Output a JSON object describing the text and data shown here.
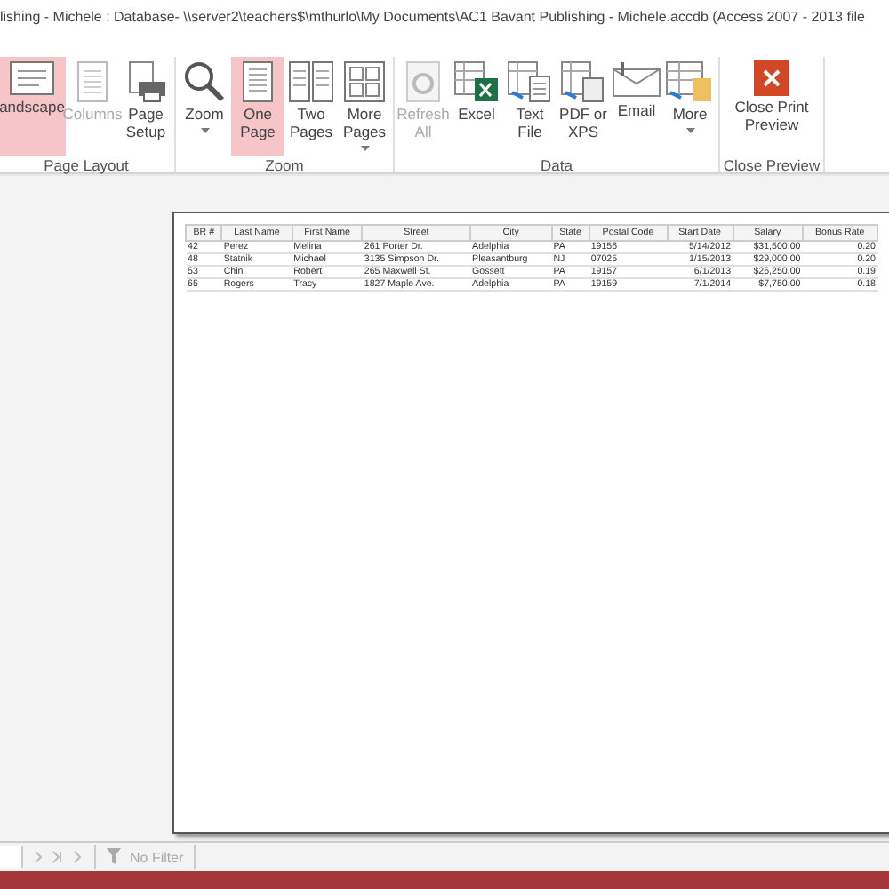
{
  "window": {
    "title": "lishing - Michele : Database- \\\\server2\\teachers$\\mthurlo\\My Documents\\AC1 Bavant Publishing - Michele.accdb (Access 2007 - 2013 file"
  },
  "ribbon": {
    "groups": [
      {
        "label": "Page Layout",
        "buttons": [
          {
            "label": "andscape",
            "selected": true,
            "disabled": false,
            "caret": false
          },
          {
            "label": "Columns",
            "selected": false,
            "disabled": true,
            "caret": false
          },
          {
            "label": "Page Setup",
            "selected": false,
            "disabled": false,
            "caret": false
          }
        ]
      },
      {
        "label": "Zoom",
        "buttons": [
          {
            "label": "Zoom",
            "selected": false,
            "disabled": false,
            "caret": true
          },
          {
            "label": "One Page",
            "selected": true,
            "disabled": false,
            "caret": false
          },
          {
            "label": "Two Pages",
            "selected": false,
            "disabled": false,
            "caret": false
          },
          {
            "label": "More Pages",
            "selected": false,
            "disabled": false,
            "caret": true
          }
        ]
      },
      {
        "label": "Data",
        "buttons": [
          {
            "label": "Refresh All",
            "selected": false,
            "disabled": true,
            "caret": false
          },
          {
            "label": "Excel",
            "selected": false,
            "disabled": false,
            "caret": false
          },
          {
            "label": "Text File",
            "selected": false,
            "disabled": false,
            "caret": false
          },
          {
            "label": "PDF or XPS",
            "selected": false,
            "disabled": false,
            "caret": false
          },
          {
            "label": "Email",
            "selected": false,
            "disabled": false,
            "caret": false
          },
          {
            "label": "More",
            "selected": false,
            "disabled": false,
            "caret": true
          }
        ]
      },
      {
        "label": "Close Preview",
        "buttons": [
          {
            "label": "Close Print Preview",
            "selected": false,
            "disabled": false,
            "caret": false
          }
        ]
      }
    ]
  },
  "report": {
    "columns": [
      "BR #",
      "Last Name",
      "First Name",
      "Street",
      "City",
      "State",
      "Postal Code",
      "Start Date",
      "Salary",
      "Bonus Rate"
    ],
    "rows": [
      [
        "42",
        "Perez",
        "Melina",
        "261 Porter Dr.",
        "Adelphia",
        "PA",
        "19156",
        "5/14/2012",
        "$31,500.00",
        "0.20"
      ],
      [
        "48",
        "Statnik",
        "Michael",
        "3135 Simpson Dr.",
        "Pleasantburg",
        "NJ",
        "07025",
        "1/15/2013",
        "$29,000.00",
        "0.20"
      ],
      [
        "53",
        "Chin",
        "Robert",
        "265 Maxwell St.",
        "Gossett",
        "PA",
        "19157",
        "6/1/2013",
        "$26,250.00",
        "0.19"
      ],
      [
        "65",
        "Rogers",
        "Tracy",
        "1827 Maple Ave.",
        "Adelphia",
        "PA",
        "19159",
        "7/1/2014",
        "$7,750.00",
        "0.18"
      ]
    ]
  },
  "navigation": {
    "filter": "No Filter"
  }
}
